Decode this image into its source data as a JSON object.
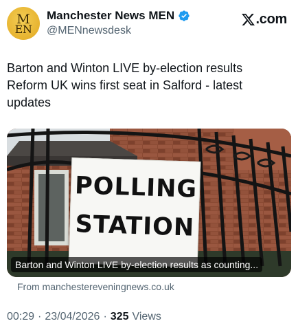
{
  "account": {
    "display_name": "Manchester News MEN",
    "handle": "@MENnewsdesk",
    "avatar_text_top": "M",
    "avatar_text_bottom": "EN",
    "avatar_color": "#e7b32f",
    "verified_color": "#1d9bf0",
    "verified_icon": "verified-badge-icon"
  },
  "brand": {
    "logo_icon": "x-logo-icon",
    "site_text": ".com"
  },
  "tweet": {
    "lines": [
      "Barton and Winton LIVE by-election results",
      "Reform UK wins first seat in Salford - latest",
      "updates"
    ]
  },
  "card": {
    "sign_line_1": "POLLING",
    "sign_line_2": "STATION",
    "caption": "Barton and Winton LIVE by-election results as counting...",
    "source": "From manchestereveningnews.co.uk"
  },
  "meta": {
    "time": "00:29",
    "date": "23/04/2026",
    "separator": "·",
    "views_count": "325",
    "views_label": "Views"
  },
  "colors": {
    "text_primary": "#0f1419",
    "text_secondary": "#536471"
  }
}
